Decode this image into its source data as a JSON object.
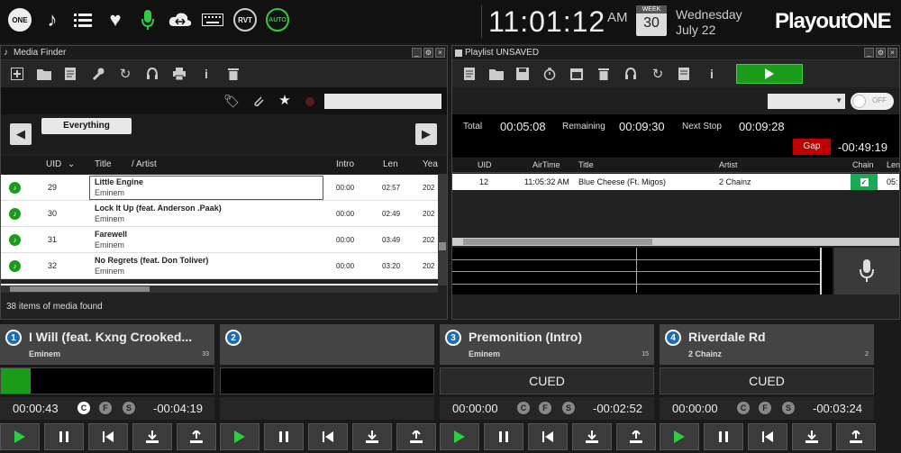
{
  "topbar": {
    "clock": "11:01:12",
    "ampm": "AM",
    "week_label": "WEEK",
    "day_num": "30",
    "weekday": "Wednesday",
    "date": "July 22",
    "logo": "PlayoutONE",
    "rvt": "RVT",
    "auto": "AUTO",
    "one_badge": "ONE"
  },
  "media_finder": {
    "title": "Media Finder",
    "filter_label": "Everything",
    "status": "38 items of media found",
    "columns": {
      "uid": "UID",
      "title": "Title",
      "artist": "/ Artist",
      "intro": "Intro",
      "len": "Len",
      "year": "Yea"
    },
    "rows": [
      {
        "uid": "29",
        "title": "Little Engine",
        "artist": "Eminem",
        "intro": "00:00",
        "len": "02:57",
        "year": "202"
      },
      {
        "uid": "30",
        "title": "Lock It Up (feat. Anderson .Paak)",
        "artist": "Eminem",
        "intro": "00:00",
        "len": "02:49",
        "year": "202"
      },
      {
        "uid": "31",
        "title": "Farewell",
        "artist": "Eminem",
        "intro": "00:00",
        "len": "03:49",
        "year": "202"
      },
      {
        "uid": "32",
        "title": "No Regrets (feat. Don Toliver)",
        "artist": "Eminem",
        "intro": "00:00",
        "len": "03:20",
        "year": "202"
      }
    ]
  },
  "playlist": {
    "title": "Playlist UNSAVED",
    "toggle": "OFF",
    "total_label": "Total",
    "total": "00:05:08",
    "remaining_label": "Remaining",
    "remaining": "00:09:30",
    "next_label": "Next Stop",
    "next": "00:09:28",
    "gap_label": "Gap",
    "gap": "-00:49:19",
    "columns": {
      "uid": "UID",
      "airtime": "AirTime",
      "title": "Title",
      "artist": "Artist",
      "chain": "Chain",
      "len": "Len"
    },
    "rows": [
      {
        "uid": "12",
        "airtime": "11:05:32 AM",
        "title": "Blue Cheese (Ft. Migos)",
        "artist": "2 Chainz",
        "len": "05:"
      }
    ]
  },
  "players": [
    {
      "num": "1",
      "title": "I Will (feat. Kxng Crooked...",
      "artist": "Eminem",
      "count": "33",
      "state": "",
      "progress": 0.14,
      "elapsed": "00:00:43",
      "remain": "-00:04:19"
    },
    {
      "num": "2",
      "title": "",
      "artist": "",
      "count": "",
      "state": "",
      "progress": 0,
      "elapsed": "",
      "remain": ""
    },
    {
      "num": "3",
      "title": "Premonition (Intro)",
      "artist": "Eminem",
      "count": "15",
      "state": "CUED",
      "progress": 0,
      "elapsed": "00:00:00",
      "remain": "-00:02:52"
    },
    {
      "num": "4",
      "title": "Riverdale Rd",
      "artist": "2 Chainz",
      "count": "2",
      "state": "CUED",
      "progress": 0,
      "elapsed": "00:00:00",
      "remain": "-00:03:24"
    }
  ],
  "cfs": {
    "c": "C",
    "f": "F",
    "s": "S"
  },
  "colors": {
    "accent_green": "#1a9c1a",
    "gap_red": "#c00000",
    "player_blue": "#1e6bb0"
  }
}
